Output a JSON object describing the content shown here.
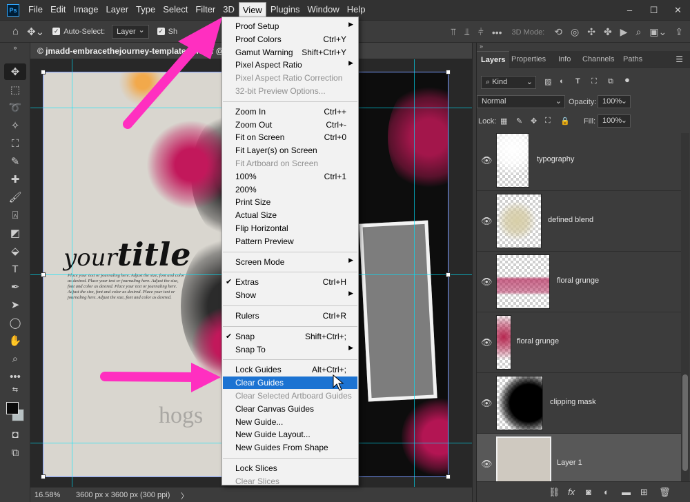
{
  "app": {
    "logo": "Ps",
    "menus": [
      "File",
      "Edit",
      "Image",
      "Layer",
      "Type",
      "Select",
      "Filter",
      "3D",
      "View",
      "Plugins",
      "Window",
      "Help"
    ],
    "active_menu": "View",
    "window_controls": [
      "–",
      "☐",
      "✕"
    ]
  },
  "options_bar": {
    "auto_select_label": "Auto-Select:",
    "auto_select_target": "Layer",
    "show_transform_label": "Sh",
    "mode_3d_label": "3D Mode:"
  },
  "document": {
    "tab_title": "© jmadd-embracethejourney-templates-no.tif @ 16.58% (Layer 1, RGB/8) *",
    "zoom": "16.58%",
    "info": "3600 px x 3600 px (300 ppi)",
    "status_arrow": "〉",
    "art": {
      "title_small": "your",
      "title_big": "title",
      "body_text": "Place your text or journaling here. Adjust the size, font and color as desired. Place your text or journaling here. Adjust the size, font and color as desired. Place your text or journaling here. Adjust the size, font and color as desired. Place your text or journaling here. Adjust the size, font and color as desired.",
      "watermark": "hogs"
    }
  },
  "view_menu": {
    "items": [
      {
        "label": "Proof Setup",
        "shortcut": "",
        "submenu": true,
        "disabled": false
      },
      {
        "label": "Proof Colors",
        "shortcut": "Ctrl+Y",
        "submenu": false,
        "disabled": false
      },
      {
        "label": "Gamut Warning",
        "shortcut": "Shift+Ctrl+Y",
        "submenu": false,
        "disabled": false
      },
      {
        "label": "Pixel Aspect Ratio",
        "shortcut": "",
        "submenu": true,
        "disabled": false
      },
      {
        "label": "Pixel Aspect Ratio Correction",
        "shortcut": "",
        "submenu": false,
        "disabled": true
      },
      {
        "label": "32-bit Preview Options...",
        "shortcut": "",
        "submenu": false,
        "disabled": true
      },
      {
        "label": "Zoom In",
        "shortcut": "Ctrl++",
        "submenu": false,
        "disabled": false
      },
      {
        "label": "Zoom Out",
        "shortcut": "Ctrl+-",
        "submenu": false,
        "disabled": false
      },
      {
        "label": "Fit on Screen",
        "shortcut": "Ctrl+0",
        "submenu": false,
        "disabled": false
      },
      {
        "label": "Fit Layer(s) on Screen",
        "shortcut": "",
        "submenu": false,
        "disabled": false
      },
      {
        "label": "Fit Artboard on Screen",
        "shortcut": "",
        "submenu": false,
        "disabled": true
      },
      {
        "label": "100%",
        "shortcut": "Ctrl+1",
        "submenu": false,
        "disabled": false
      },
      {
        "label": "200%",
        "shortcut": "",
        "submenu": false,
        "disabled": false
      },
      {
        "label": "Print Size",
        "shortcut": "",
        "submenu": false,
        "disabled": false
      },
      {
        "label": "Actual Size",
        "shortcut": "",
        "submenu": false,
        "disabled": false
      },
      {
        "label": "Flip Horizontal",
        "shortcut": "",
        "submenu": false,
        "disabled": false
      },
      {
        "label": "Pattern Preview",
        "shortcut": "",
        "submenu": false,
        "disabled": false
      },
      {
        "label": "Screen Mode",
        "shortcut": "",
        "submenu": true,
        "disabled": false
      },
      {
        "label": "Extras",
        "shortcut": "Ctrl+H",
        "submenu": false,
        "disabled": false,
        "checked": true
      },
      {
        "label": "Show",
        "shortcut": "",
        "submenu": true,
        "disabled": false
      },
      {
        "label": "Rulers",
        "shortcut": "Ctrl+R",
        "submenu": false,
        "disabled": false
      },
      {
        "label": "Snap",
        "shortcut": "Shift+Ctrl+;",
        "submenu": false,
        "disabled": false,
        "checked": true
      },
      {
        "label": "Snap To",
        "shortcut": "",
        "submenu": true,
        "disabled": false
      },
      {
        "label": "Lock Guides",
        "shortcut": "Alt+Ctrl+;",
        "submenu": false,
        "disabled": false
      },
      {
        "label": "Clear Guides",
        "shortcut": "",
        "submenu": false,
        "disabled": false,
        "highlighted": true
      },
      {
        "label": "Clear Selected Artboard Guides",
        "shortcut": "",
        "submenu": false,
        "disabled": true
      },
      {
        "label": "Clear Canvas Guides",
        "shortcut": "",
        "submenu": false,
        "disabled": false
      },
      {
        "label": "New Guide...",
        "shortcut": "",
        "submenu": false,
        "disabled": false
      },
      {
        "label": "New Guide Layout...",
        "shortcut": "",
        "submenu": false,
        "disabled": false
      },
      {
        "label": "New Guides From Shape",
        "shortcut": "",
        "submenu": false,
        "disabled": false
      },
      {
        "label": "Lock Slices",
        "shortcut": "",
        "submenu": false,
        "disabled": false
      },
      {
        "label": "Clear Slices",
        "shortcut": "",
        "submenu": false,
        "disabled": true
      }
    ],
    "separator_after": [
      5,
      16,
      17,
      19,
      20,
      22,
      29
    ],
    "check_mark": "✔",
    "submenu_arrow": "▶"
  },
  "layers_panel": {
    "tabs": [
      "Layers",
      "Properties",
      "Info",
      "Channels",
      "Paths"
    ],
    "active_tab": "Layers",
    "filter_kind": "Kind",
    "blend_mode": "Normal",
    "opacity_label": "Opacity:",
    "opacity": "100%",
    "lock_label": "Lock:",
    "fill_label": "Fill:",
    "fill": "100%",
    "layers": [
      {
        "name": "typography",
        "visible": true,
        "selected": false
      },
      {
        "name": "defined blend",
        "visible": true,
        "selected": false
      },
      {
        "name": "floral grunge",
        "visible": true,
        "selected": false
      },
      {
        "name": "floral grunge",
        "visible": true,
        "selected": false
      },
      {
        "name": "clipping mask",
        "visible": true,
        "selected": false
      },
      {
        "name": "Layer 1",
        "visible": true,
        "selected": true
      }
    ]
  },
  "colors": {
    "menu_highlight": "#1c73d2",
    "callout_arrow": "#ff2fc0",
    "guide": "#00e6ff",
    "accent_pink": "#c2185b"
  }
}
